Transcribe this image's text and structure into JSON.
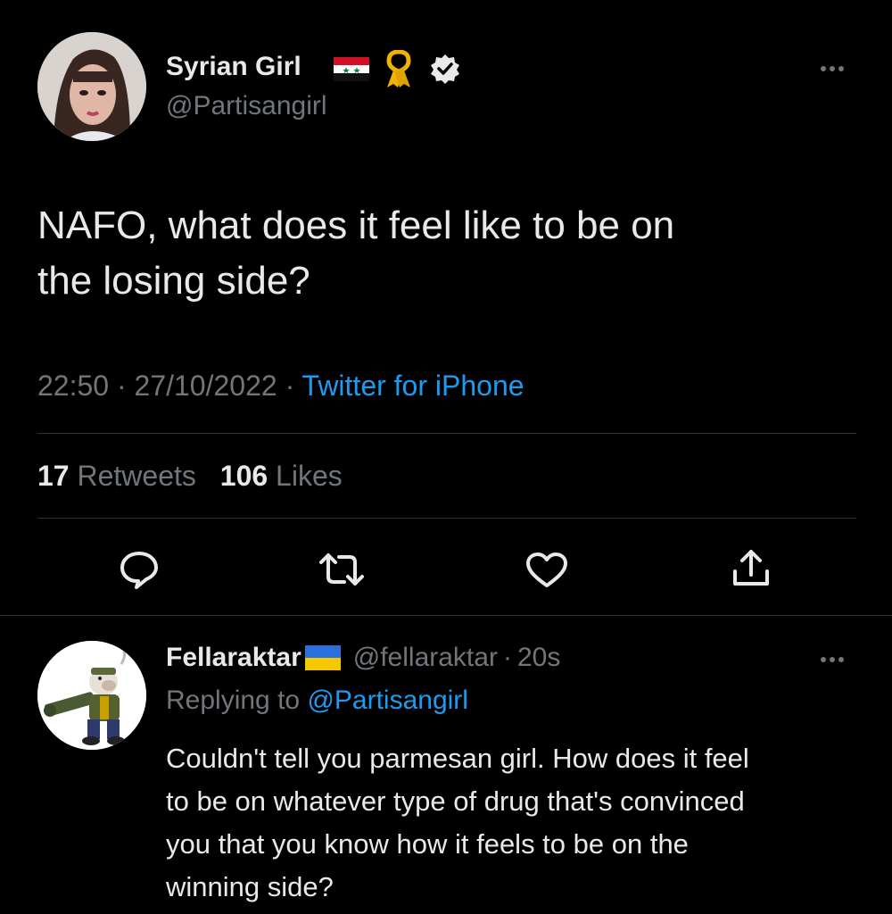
{
  "tweet": {
    "author_name": "Syrian Girl",
    "author_handle": "@Partisangirl",
    "text_line1": "NAFO, what does it feel like to be on",
    "text_line2": "the losing side?",
    "time": "22:50",
    "date": "27/10/2022",
    "separator": "·",
    "source": "Twitter for iPhone",
    "retweets_count": "17",
    "retweets_label": "Retweets",
    "likes_count": "106",
    "likes_label": "Likes"
  },
  "reply": {
    "author_name": "Fellaraktar",
    "author_handle": "@fellaraktar",
    "time_ago": "20s",
    "separator": "·",
    "replying_label": "Replying to",
    "replying_handle": "@Partisangirl",
    "text_line1": "Couldn't tell you parmesan girl. How does it feel",
    "text_line2": "to be on whatever type of drug that's convinced",
    "text_line3": "you that you know how it feels to be on the",
    "text_line4": "winning side?"
  },
  "colors": {
    "background": "#000000",
    "text": "#e7e9ea",
    "muted": "#71767b",
    "link": "#1d9bf0",
    "divider": "#2f3336"
  },
  "icons": [
    "syria-flag-icon",
    "yellow-ribbon-icon",
    "verified-badge-icon",
    "more-icon",
    "reply-icon",
    "retweet-icon",
    "like-icon",
    "share-icon",
    "ukraine-flag-icon"
  ]
}
